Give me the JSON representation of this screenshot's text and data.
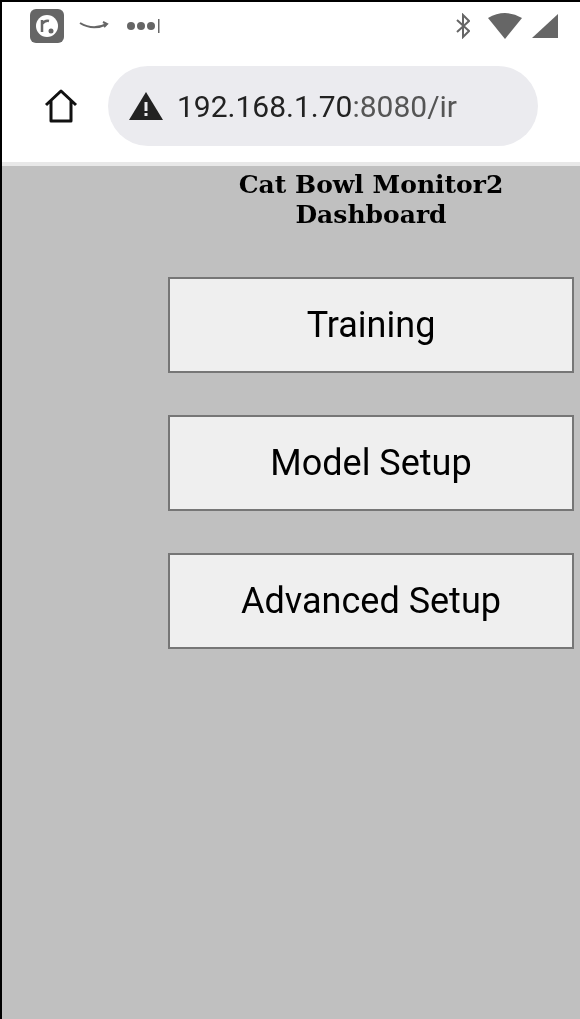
{
  "browser": {
    "url_host": "192.168.1.70",
    "url_rest": ":8080/ir"
  },
  "page": {
    "title": "Cat Bowl Monitor2",
    "subtitle": "Dashboard",
    "buttons": [
      "Training",
      "Model Setup",
      "Advanced Setup"
    ]
  }
}
